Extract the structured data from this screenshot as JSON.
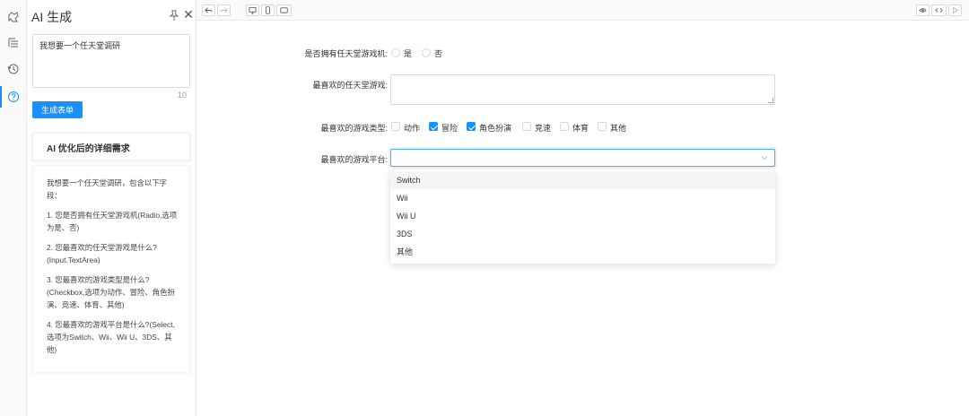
{
  "panel": {
    "title": "AI 生成",
    "prompt_value": "我想要一个任天堂调研",
    "char_count": "10",
    "generate_button": "生成表单",
    "optimized_header": "AI 优化后的详细需求",
    "optimized_paragraphs": [
      "我想要一个任天堂调研，包含以下字段：",
      "1. 您是否拥有任天堂游戏机(Radio,选项为是、否)",
      "2. 您最喜欢的任天堂游戏是什么?(Input.TextArea)",
      "3. 您最喜欢的游戏类型是什么?(Checkbox,选项为动作、冒险、角色扮演、竞速、体育、其他)",
      "4. 您最喜欢的游戏平台是什么?(Select,选项为Switch、Wii、Wii U、3DS、其他)"
    ]
  },
  "form": {
    "own_console_label": "是否拥有任天堂游戏机:",
    "own_console_options": [
      "是",
      "否"
    ],
    "favorite_game_label": "最喜欢的任天堂游戏:",
    "game_type_label": "最喜欢的游戏类型:",
    "game_types": [
      {
        "label": "动作",
        "checked": false
      },
      {
        "label": "冒险",
        "checked": true
      },
      {
        "label": "角色扮演",
        "checked": true
      },
      {
        "label": "竞速",
        "checked": false
      },
      {
        "label": "体育",
        "checked": false
      },
      {
        "label": "其他",
        "checked": false
      }
    ],
    "platform_label": "最喜欢的游戏平台:",
    "platform_options": [
      "Switch",
      "Wii",
      "Wii U",
      "3DS",
      "其他"
    ],
    "platform_highlighted": "Switch"
  },
  "icons": {
    "rail": [
      "component-icon",
      "outline-icon",
      "history-icon",
      "help-icon"
    ],
    "toolbar_left": [
      "undo-icon",
      "redo-icon"
    ],
    "toolbar_devices": [
      "desktop-icon",
      "mobile-icon",
      "tablet-icon"
    ],
    "toolbar_right": [
      "preview-icon",
      "code-icon",
      "play-icon"
    ]
  },
  "colors": {
    "primary": "#1890ff",
    "border": "#d9d9d9",
    "select_focus": "#5cabf0"
  }
}
